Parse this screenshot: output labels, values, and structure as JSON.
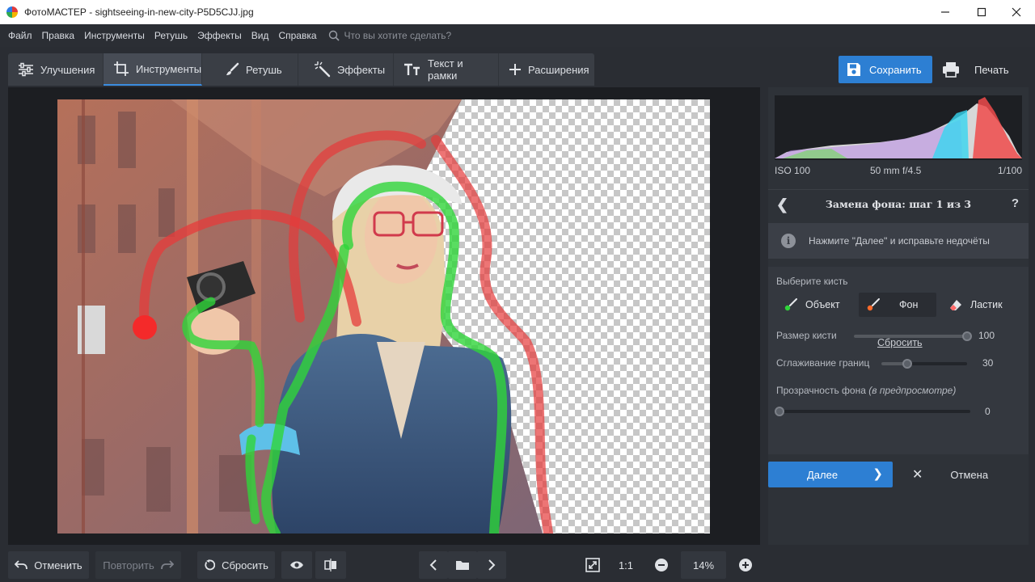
{
  "window": {
    "app_name": "ФотоМАСТЕР",
    "title": "ФотоМАСТЕР - sightseeing-in-new-city-P5D5CJJ.jpg",
    "controls": [
      "minimize-icon",
      "maximize-icon",
      "close-icon"
    ]
  },
  "menu": {
    "items": [
      "Файл",
      "Правка",
      "Инструменты",
      "Ретушь",
      "Эффекты",
      "Вид",
      "Справка"
    ],
    "search_placeholder": "Что вы хотите сделать?"
  },
  "tabs": [
    {
      "label": "Улучшения",
      "icon": "sliders-icon",
      "active": false
    },
    {
      "label": "Инструменты",
      "icon": "crop-icon",
      "active": true
    },
    {
      "label": "Ретушь",
      "icon": "brush-icon",
      "active": false
    },
    {
      "label": "Эффекты",
      "icon": "magic-wand-icon",
      "active": false
    },
    {
      "label": "Текст и рамки",
      "icon": "text-icon",
      "active": false
    },
    {
      "label": "Расширения",
      "icon": "plus-icon",
      "active": false
    }
  ],
  "actions": {
    "save_label": "Сохранить",
    "print_label": "Печать"
  },
  "exif": {
    "iso": "ISO 100",
    "lens": "50 mm f/4.5",
    "shutter": "1/100"
  },
  "panel": {
    "step_title": "Замена фона: шаг 1 из 3",
    "help_label": "?",
    "hint": "Нажмите \"Далее\" и исправьте недочёты",
    "choose_brush_label": "Выберите кисть",
    "brushes": [
      {
        "label": "Объект",
        "active": false
      },
      {
        "label": "Фон",
        "active": true
      },
      {
        "label": "Ластик",
        "active": false
      }
    ],
    "brush_size": {
      "label": "Размер кисти",
      "value": "100",
      "level": 1.0
    },
    "edge_smoothing": {
      "label": "Сглаживание границ",
      "value": "30",
      "level": 0.3
    },
    "bg_transparency": {
      "label": "Прозрачность фона",
      "note": "(в предпросмотре)",
      "value": "0",
      "level": 0.0
    },
    "reset_link": "Сбросить",
    "next_label": "Далее",
    "cancel_label": "Отмена"
  },
  "bottom": {
    "undo_label": "Отменить",
    "redo_label": "Повторить",
    "reset_label": "Сбросить",
    "one_to_one": "1:1",
    "zoom": "14%"
  },
  "colors": {
    "accent": "#2d7fd3",
    "object_stroke": "#2fd43a",
    "background_stroke": "#e63b3b",
    "panel_bg": "#2e3238",
    "app_bg": "#2a2d33"
  }
}
